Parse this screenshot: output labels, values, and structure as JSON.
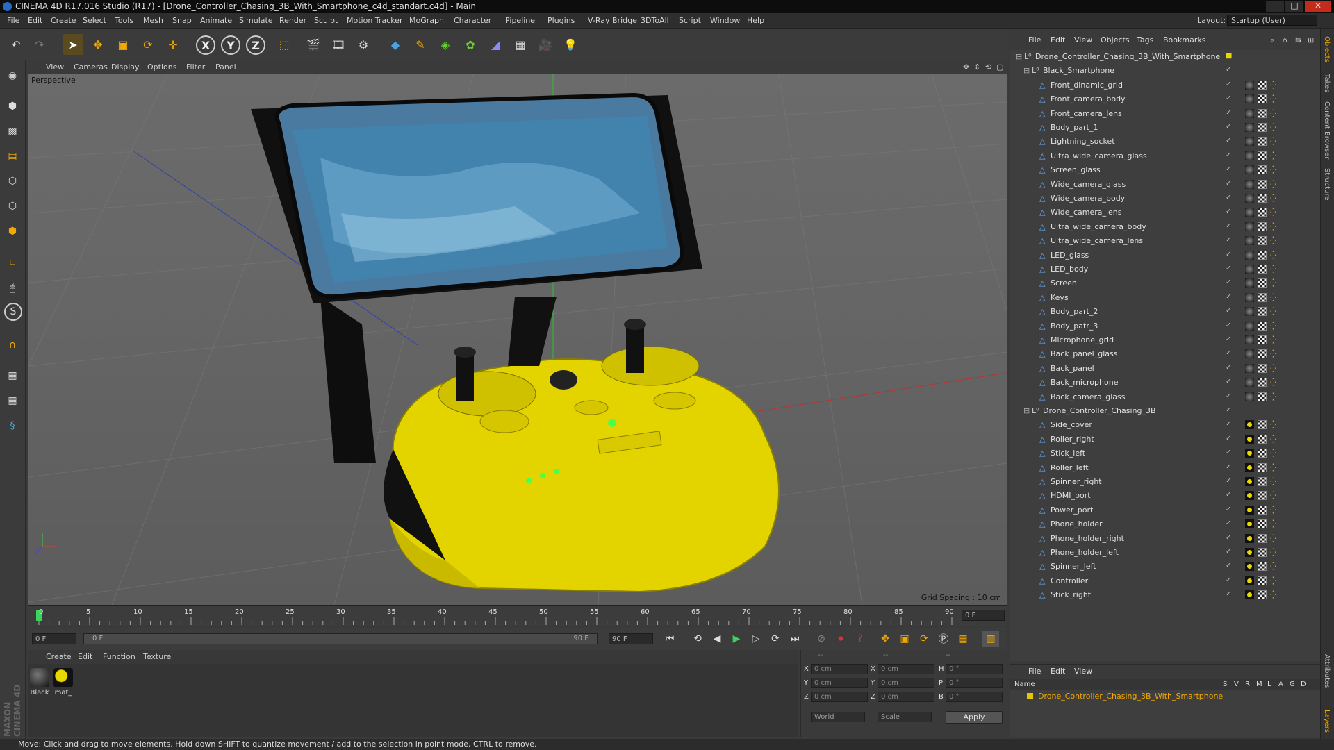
{
  "app": {
    "title": "CINEMA 4D R17.016 Studio (R17) - [Drone_Controller_Chasing_3B_With_Smartphone_c4d_standart.c4d] - Main",
    "window_controls": [
      "–",
      "□",
      "✕"
    ]
  },
  "menu": [
    "File",
    "Edit",
    "Create",
    "Select",
    "Tools",
    "Mesh",
    "Snap",
    "Animate",
    "Simulate",
    "Render",
    "Sculpt",
    "Motion Tracker",
    "MoGraph",
    "Character",
    "Pipeline",
    "Plugins",
    "V-Ray Bridge",
    "3DToAll",
    "Script",
    "Window",
    "Help"
  ],
  "layout": {
    "label": "Layout:",
    "value": "Startup (User)"
  },
  "toolbar": {
    "undo": "undo-icon",
    "redo": "redo-icon",
    "select": "arrow-icon",
    "move": "move-icon",
    "scale": "scale-icon",
    "rotate": "rotate-icon",
    "add": "plus-icon",
    "axis_x": "X",
    "axis_y": "Y",
    "axis_z": "Z"
  },
  "viewport": {
    "menu": [
      "View",
      "Cameras",
      "Display",
      "Options",
      "Filter",
      "Panel"
    ],
    "label": "Perspective",
    "grid_spacing": "Grid Spacing : 10 cm"
  },
  "timeline": {
    "ticks": [
      "0",
      "5",
      "10",
      "15",
      "20",
      "25",
      "30",
      "35",
      "40",
      "45",
      "50",
      "55",
      "60",
      "65",
      "70",
      "75",
      "80",
      "85",
      "90"
    ],
    "current_frame": "0 F",
    "start_field": "0 F",
    "range_start": "0 F",
    "range_end": "90 F",
    "end_field": "90 F"
  },
  "materials": {
    "menu": [
      "Create",
      "Edit",
      "Function",
      "Texture"
    ],
    "items": [
      {
        "name": "Black"
      },
      {
        "name": "mat_"
      }
    ]
  },
  "coords": {
    "headers": [
      "--",
      "--",
      "--"
    ],
    "rows": [
      {
        "a": "X",
        "av": "0 cm",
        "b": "X",
        "bv": "0 cm",
        "c": "H",
        "cv": "0 °"
      },
      {
        "a": "Y",
        "av": "0 cm",
        "b": "Y",
        "bv": "0 cm",
        "c": "P",
        "cv": "0 °"
      },
      {
        "a": "Z",
        "av": "0 cm",
        "b": "Z",
        "bv": "0 cm",
        "c": "B",
        "cv": "0 °"
      }
    ],
    "world": "World",
    "scale": "Scale",
    "apply": "Apply"
  },
  "status": "Move: Click and drag to move elements. Hold down SHIFT to quantize movement / add to the selection in point mode, CTRL to remove.",
  "objects": {
    "menu": [
      "File",
      "Edit",
      "View",
      "Objects",
      "Tags",
      "Bookmarks"
    ],
    "root": "Drone_Controller_Chasing_3B_With_Smartphone",
    "group1": "Black_Smartphone",
    "group1_items": [
      "Front_dinamic_grid",
      "Front_camera_body",
      "Front_camera_lens",
      "Body_part_1",
      "Lightning_socket",
      "Ultra_wide_camera_glass",
      "Screen_glass",
      "Wide_camera_glass",
      "Wide_camera_body",
      "Wide_camera_lens",
      "Ultra_wide_camera_body",
      "Ultra_wide_camera_lens",
      "LED_glass",
      "LED_body",
      "Screen",
      "Keys",
      "Body_part_2",
      "Body_patr_3",
      "Microphone_grid",
      "Back_panel_glass",
      "Back_panel",
      "Back_microphone",
      "Back_camera_glass"
    ],
    "group2": "Drone_Controller_Chasing_3B",
    "group2_items": [
      "Side_cover",
      "Roller_right",
      "Stick_left",
      "Roller_left",
      "Spinner_right",
      "HDMI_port",
      "Power_port",
      "Phone_holder",
      "Phone_holder_right",
      "Phone_holder_left",
      "Spinner_left",
      "Controller",
      "Stick_right"
    ]
  },
  "attributes": {
    "menu": [
      "File",
      "Edit",
      "View"
    ],
    "columns": [
      "Name",
      "S",
      "V",
      "R",
      "M",
      "L",
      "A",
      "G",
      "D"
    ],
    "item": "Drone_Controller_Chasing_3B_With_Smartphone"
  },
  "side_tabs": [
    "Objects",
    "Takes",
    "Content Browser",
    "Structure",
    "Attributes",
    "Layers"
  ],
  "branding": "MAXON CINEMA 4D",
  "colors": {
    "accent": "#f2a900",
    "yellow": "#e8d700",
    "selection": "#d09a00"
  }
}
